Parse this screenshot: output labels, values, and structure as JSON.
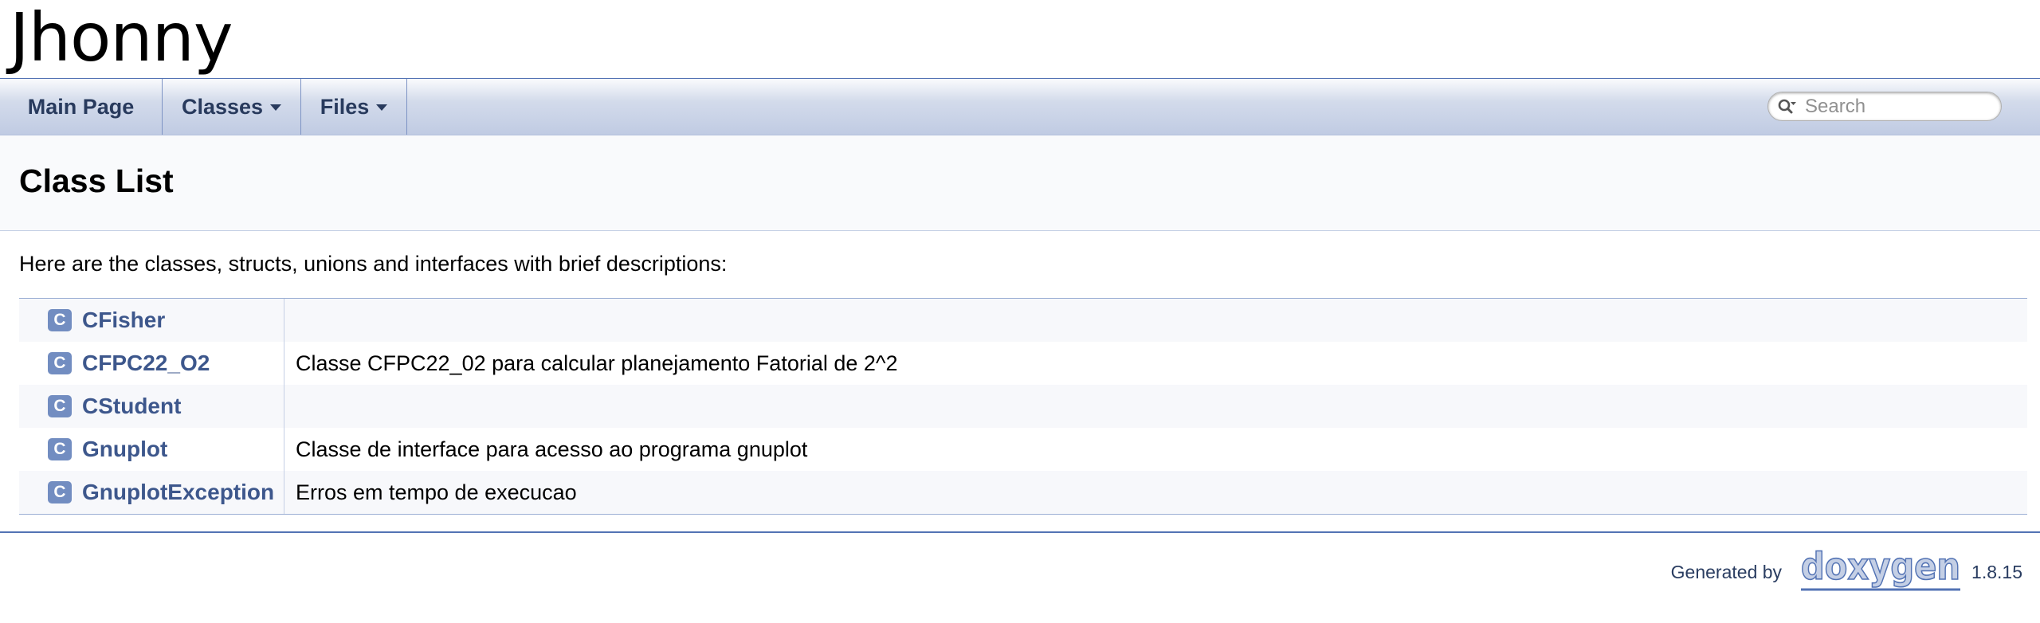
{
  "project": {
    "name": "Jhonny"
  },
  "navbar": {
    "items": [
      {
        "label": "Main Page",
        "has_menu": false
      },
      {
        "label": "Classes",
        "has_menu": true
      },
      {
        "label": "Files",
        "has_menu": true
      }
    ],
    "search": {
      "placeholder": "Search",
      "icon": "magnifier-dropdown-icon"
    }
  },
  "header": {
    "title": "Class List"
  },
  "contents": {
    "intro": "Here are the classes, structs, unions and interfaces with brief descriptions:",
    "classes": [
      {
        "icon": "C",
        "name": "CFisher",
        "description": ""
      },
      {
        "icon": "C",
        "name": "CFPC22_O2",
        "description": "Classe CFPC22_02 para calcular planejamento Fatorial de 2^2"
      },
      {
        "icon": "C",
        "name": "CStudent",
        "description": ""
      },
      {
        "icon": "C",
        "name": "Gnuplot",
        "description": "Classe de interface para acesso ao programa gnuplot"
      },
      {
        "icon": "C",
        "name": "GnuplotException",
        "description": "Erros em tempo de execucao"
      }
    ]
  },
  "footer": {
    "generated_by": "Generated by",
    "logo_text": "doxygen",
    "version": "1.8.15"
  },
  "colors": {
    "link": "#3D578C",
    "nav_text": "#283A5D",
    "icon_bg": "#728DC1",
    "border": "#5373B4",
    "row_alt": "#F7F8FB"
  }
}
